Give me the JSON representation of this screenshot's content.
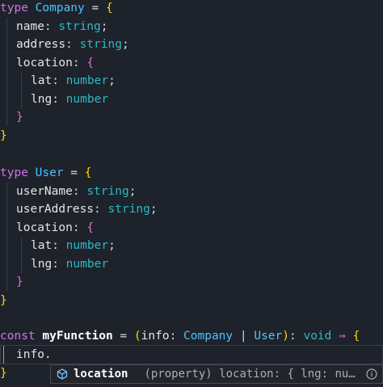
{
  "colors": {
    "background": "#1e222a",
    "keyword": "#cd74e8",
    "type_name": "#4fc1ff",
    "primitive": "#2bbac5",
    "brace_level1": "#ffd700",
    "brace_level2": "#da70d6"
  },
  "code": {
    "line1": {
      "kw": "type",
      "name": "Company",
      "eq": " = ",
      "brace": "{"
    },
    "line2": {
      "prop": "name",
      "colon": ": ",
      "type": "string",
      "semi": ";"
    },
    "line3": {
      "prop": "address",
      "colon": ": ",
      "type": "string",
      "semi": ";"
    },
    "line4": {
      "prop": "location",
      "colon": ": ",
      "brace": "{"
    },
    "line5": {
      "prop": "lat",
      "colon": ": ",
      "type": "number",
      "semi": ";"
    },
    "line6": {
      "prop": "lng",
      "colon": ": ",
      "type": "number"
    },
    "line7": {
      "brace": "}"
    },
    "line8": {
      "brace": "}"
    },
    "line10": {
      "kw": "type",
      "name": "User",
      "eq": " = ",
      "brace": "{"
    },
    "line11": {
      "prop": "userName",
      "colon": ": ",
      "type": "string",
      "semi": ";"
    },
    "line12": {
      "prop": "userAddress",
      "colon": ": ",
      "type": "string",
      "semi": ";"
    },
    "line13": {
      "prop": "location",
      "colon": ": ",
      "brace": "{"
    },
    "line14": {
      "prop": "lat",
      "colon": ": ",
      "type": "number",
      "semi": ";"
    },
    "line15": {
      "prop": "lng",
      "colon": ": ",
      "type": "number"
    },
    "line16": {
      "brace": "}"
    },
    "line17": {
      "brace": "}"
    },
    "line19": {
      "kw": "const",
      "fn": "myFunction",
      "eq": " = ",
      "paren_open": "(",
      "param": "info",
      "colon": ": ",
      "type1": "Company",
      "pipe": " | ",
      "type2": "User",
      "paren_close": ")",
      "colon2": ": ",
      "ret": "void",
      "arrow": " ⇒ ",
      "brace": "{"
    },
    "line20": {
      "text": "info."
    },
    "line21": {
      "brace": "}"
    }
  },
  "suggestion": {
    "icon": "property-cube-icon",
    "label": "location",
    "detail": "(property) location: { lng: nu…"
  }
}
